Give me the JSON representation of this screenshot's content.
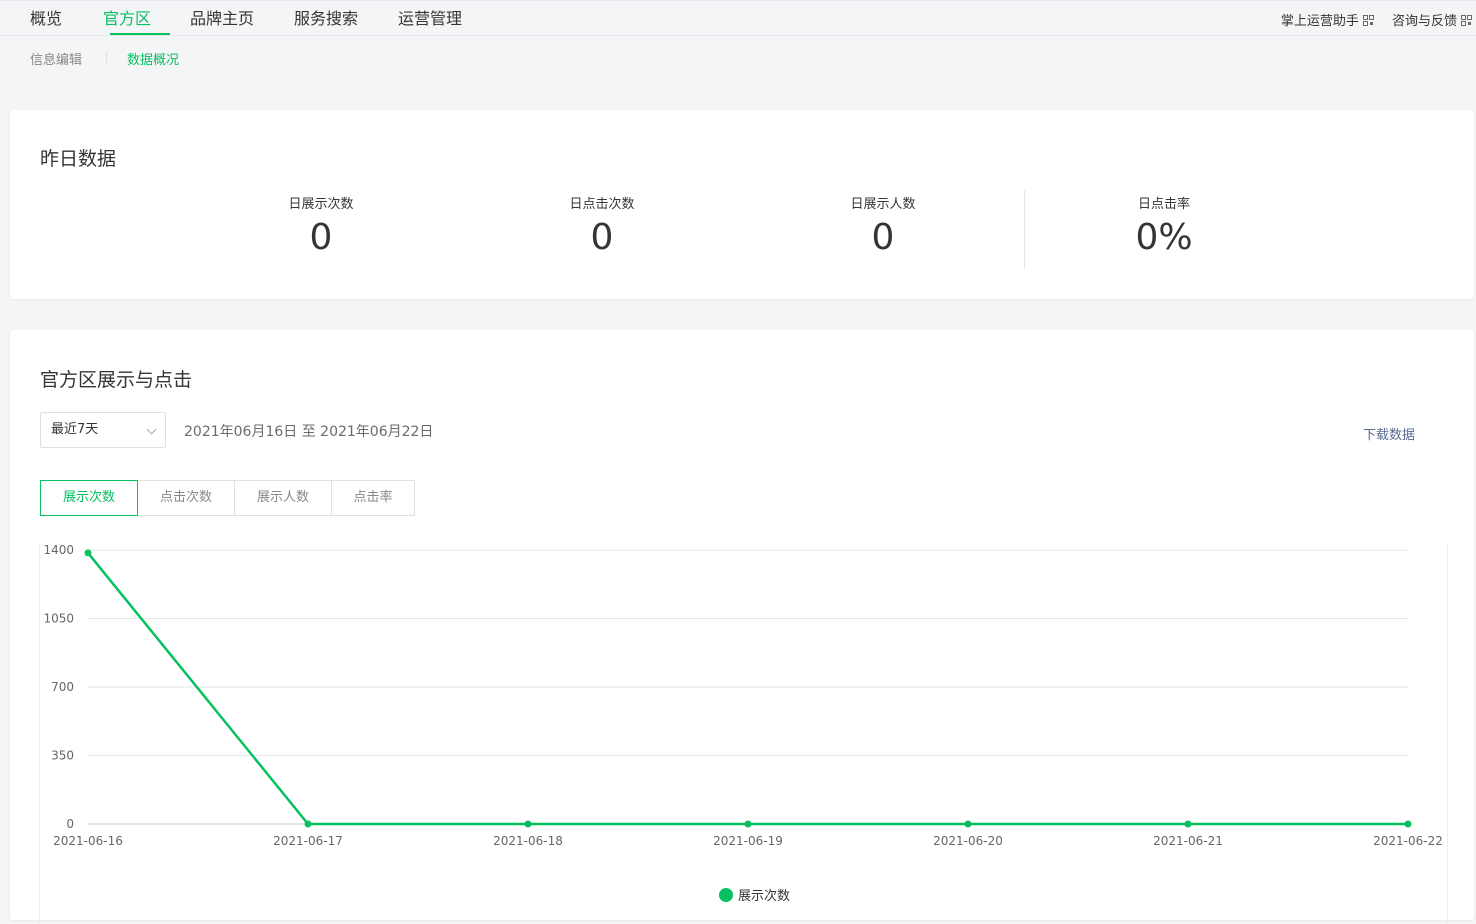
{
  "topnav": {
    "tabs": [
      {
        "label": "概览",
        "active": false
      },
      {
        "label": "官方区",
        "active": true
      },
      {
        "label": "品牌主页",
        "active": false
      },
      {
        "label": "服务搜索",
        "active": false
      },
      {
        "label": "运营管理",
        "active": false
      }
    ],
    "links": {
      "assistant": "掌上运营助手",
      "feedback": "咨询与反馈"
    }
  },
  "subnav": {
    "items": [
      {
        "label": "信息编辑",
        "active": false
      },
      {
        "label": "数据概况",
        "active": true
      }
    ]
  },
  "yesterday": {
    "title": "昨日数据",
    "stats": [
      {
        "label": "日展示次数",
        "value": "0"
      },
      {
        "label": "日点击次数",
        "value": "0"
      },
      {
        "label": "日展示人数",
        "value": "0"
      },
      {
        "label": "日点击率",
        "value": "0%"
      }
    ]
  },
  "trend": {
    "title": "官方区展示与点击",
    "range_select": "最近7天",
    "date_range": "2021年06月16日 至 2021年06月22日",
    "download": "下载数据",
    "metric_tabs": [
      {
        "label": "展示次数",
        "active": true
      },
      {
        "label": "点击次数",
        "active": false
      },
      {
        "label": "展示人数",
        "active": false
      },
      {
        "label": "点击率",
        "active": false
      }
    ]
  },
  "colors": {
    "accent": "#07c160",
    "link": "#576b95"
  },
  "chart_data": {
    "type": "line",
    "x": [
      "2021-06-16",
      "2021-06-17",
      "2021-06-18",
      "2021-06-19",
      "2021-06-20",
      "2021-06-21",
      "2021-06-22"
    ],
    "series": [
      {
        "name": "展示次数",
        "values": [
          1385,
          0,
          0,
          0,
          0,
          0,
          0
        ],
        "color": "#07c160"
      }
    ],
    "yticks": [
      0,
      350,
      700,
      1050,
      1400
    ],
    "ylim": [
      0,
      1400
    ],
    "grid": true,
    "legend": "bottom-center"
  }
}
